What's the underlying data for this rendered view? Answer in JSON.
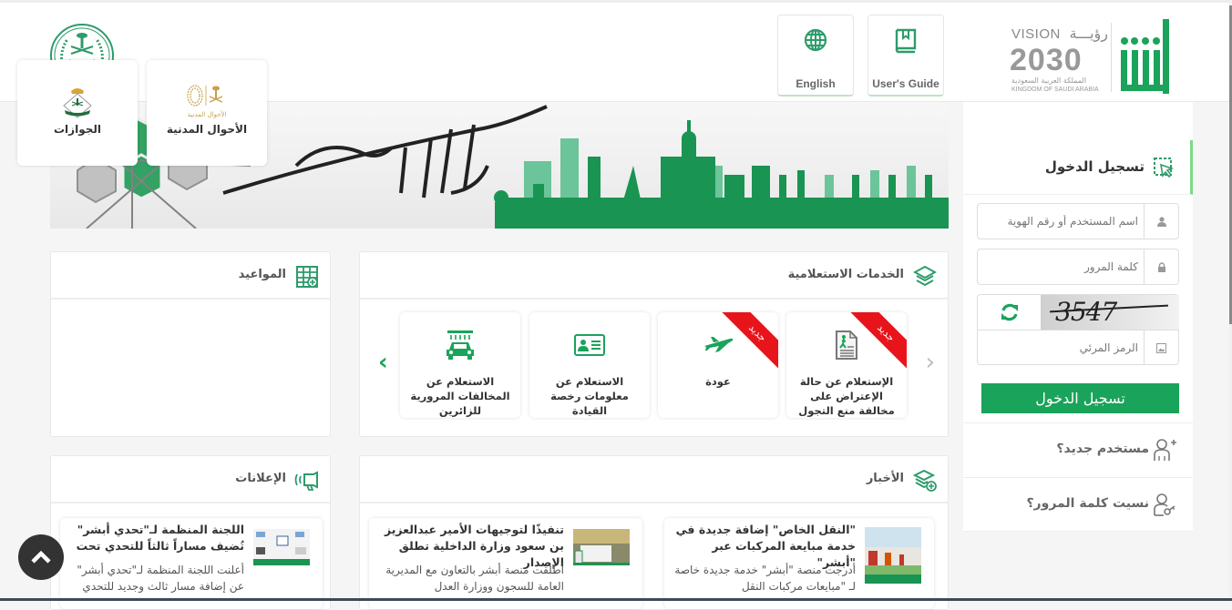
{
  "header": {
    "logo": "absher-logo",
    "vision": {
      "line1": "VISION",
      "line1_ar": "رؤيـــة",
      "year": "2030",
      "country_ar": "المملكة العربية السعودية",
      "country_en": "KINGDOM OF SAUDI ARABIA"
    },
    "buttons": [
      {
        "label": "User's Guide",
        "icon": "book-icon"
      },
      {
        "label": "English",
        "icon": "globe-icon"
      }
    ],
    "moi_logo": "ministry-of-interior-emblem"
  },
  "banner": {
    "calligraphy": "كل عام وأنتم بخير"
  },
  "login": {
    "title": "تسجيل الدخول",
    "username_placeholder": "اسم المستخدم أو رقم الهوية",
    "password_placeholder": "كلمة المرور",
    "captcha_text": "3547",
    "captcha_placeholder": "الرمز المرئي",
    "submit_label": "تسجيل الدخول",
    "new_user_label": "مستخدم جديد؟",
    "forgot_password_label": "نسيت كلمة المرور؟"
  },
  "inquiry_services": {
    "title": "الخدمات الاستعلامية",
    "items": [
      {
        "label": "الإستعلام عن حالة الإعتراض على مخالفة منع التجول",
        "badge": "جديد",
        "icon": "document-person-icon"
      },
      {
        "label": "عودة",
        "badge": "جديد",
        "icon": "airplane-icon"
      },
      {
        "label": "الاستعلام عن معلومات رخصة القيادة",
        "badge": "",
        "icon": "id-card-icon"
      },
      {
        "label": "الاستعلام عن المخالفات المرورية للزائرين",
        "badge": "",
        "icon": "car-wash-icon"
      }
    ]
  },
  "appointments": {
    "title": "المواعيد",
    "items": [
      {
        "label": "الأحوال المدنية",
        "sublabel": "الأحوال المدنية"
      },
      {
        "label": "الجوازات"
      }
    ]
  },
  "news": {
    "title": "الأخبار",
    "items": [
      {
        "title": "\"النقل الخاص\" إضافة جديدة في خدمة مبايعة المركبات عبر \"أبشر\"",
        "desc": "أدرجت منصة \"أبشر\" خدمة جديدة خاصة لـ \"مبايعات مركبات النقل"
      },
      {
        "title": "تنفيذًا لتوجيهات الأمير عبدالعزيز بن سعود وزارة الداخلية تطلق الإصدار",
        "desc": "أطلقت منصة أبشر بالتعاون مع المديرية العامة للسجون ووزارة العدل"
      }
    ]
  },
  "announcements": {
    "title": "الإعلانات",
    "items": [
      {
        "title": "اللجنة المنظمة لـ\"تحدي أبشر\" تُضيف مساراً ثالثاً للتحدي تحت",
        "desc": "أعلنت اللجنة المنظمة لـ\"تحدي أبشر\" عن إضافة مسار ثالث وجديد للتحدي"
      }
    ]
  },
  "colors": {
    "brand_green": "#1aa35a",
    "icon_green": "#2e9b6a",
    "badge_red": "#e8141b"
  }
}
